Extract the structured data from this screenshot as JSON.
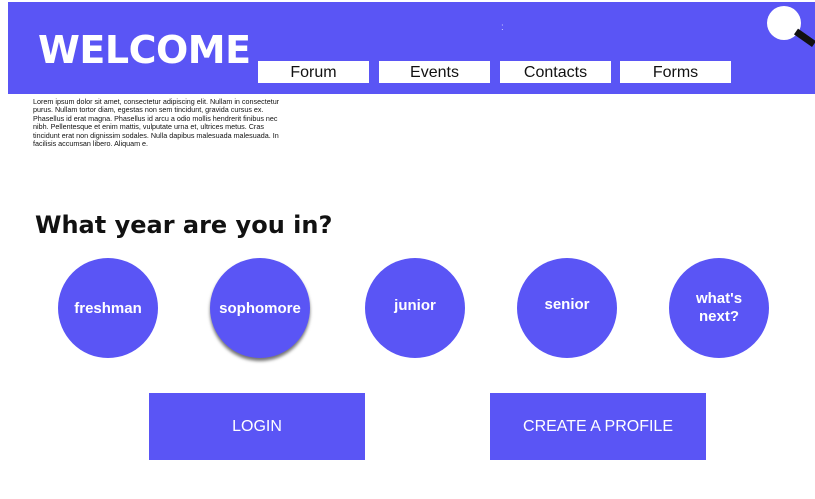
{
  "header": {
    "title": "WELCOME",
    "dot": ":",
    "nav": [
      "Forum",
      "Events",
      "Contacts",
      "Forms"
    ],
    "search_icon": "magnifier-icon"
  },
  "intro": {
    "text": "Lorem ipsum dolor sit amet, consectetur adipiscing elit. Nullam in consectetur purus. Nullam tortor diam, egestas non sem tincidunt, gravida cursus ex. Phasellus id erat magna. Phasellus id arcu a odio mollis hendrerit finibus nec nibh. Pellentesque et enim mattis, vulputate urna et, ultrices metus. Cras tincidunt erat non dignissim sodales. Nulla dapibus malesuada malesuada. In facilisis accumsan libero. Aliquam e."
  },
  "question": "What year are you in?",
  "years": [
    "freshman",
    "sophomore",
    "junior",
    "senior",
    "what's next?"
  ],
  "actions": {
    "login": "LOGIN",
    "create_profile": "CREATE A PROFILE"
  },
  "colors": {
    "accent": "#5a55f5",
    "text": "#111111",
    "background": "#ffffff"
  }
}
